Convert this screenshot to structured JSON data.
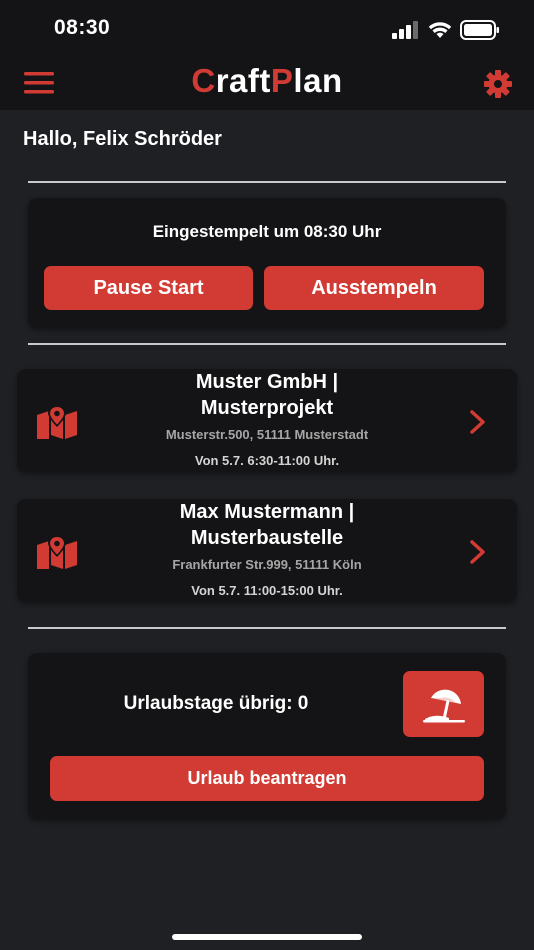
{
  "status_bar": {
    "time": "08:30"
  },
  "header": {
    "brand_first_letter": "C",
    "brand_part1": "raft",
    "brand_second_letter": "P",
    "brand_part2": "lan"
  },
  "greeting": "Hallo, Felix Schröder",
  "clock": {
    "status_text": "Eingestempelt um 08:30 Uhr",
    "pause_label": "Pause Start",
    "clock_out_label": "Ausstempeln"
  },
  "projects": [
    {
      "title_line1": "Muster GmbH |",
      "title_line2": "Musterprojekt",
      "address": "Musterstr.500, 51111 Musterstadt",
      "time": "Von 5.7. 6:30-11:00 Uhr."
    },
    {
      "title_line1": "Max Mustermann |",
      "title_line2": "Musterbaustelle",
      "address": "Frankfurter Str.999, 51111 Köln",
      "time": "Von 5.7. 11:00-15:00 Uhr."
    }
  ],
  "vacation": {
    "remaining_text": "Urlaubstage übrig: 0",
    "request_label": "Urlaub beantragen"
  },
  "colors": {
    "accent": "#d23b34",
    "background": "#1f2024",
    "card": "#141416"
  },
  "icons": [
    "menu-icon",
    "gear-icon",
    "map-pin-icon",
    "chevron-right-icon",
    "beach-umbrella-icon"
  ]
}
